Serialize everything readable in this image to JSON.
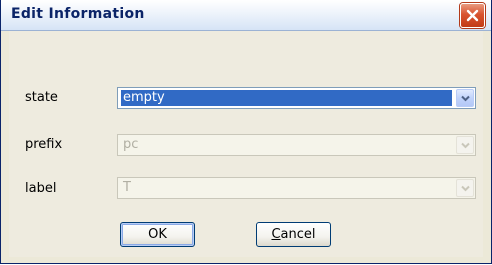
{
  "window": {
    "title": "Edit Information"
  },
  "fields": [
    {
      "label": "state",
      "value": "empty",
      "enabled": true
    },
    {
      "label": "prefix",
      "value": "pc",
      "enabled": false
    },
    {
      "label": "label",
      "value": "T",
      "enabled": false
    }
  ],
  "buttons": {
    "ok_label": "OK",
    "cancel_mnemonic": "C",
    "cancel_rest": "ancel"
  },
  "icons": {
    "close": "close-icon",
    "dropdown": "chevron-down-icon"
  },
  "colors": {
    "title_text": "#0b2468",
    "close_button": "#d9532f",
    "selection": "#316ac5",
    "dialog_bg": "#eeebdf"
  }
}
